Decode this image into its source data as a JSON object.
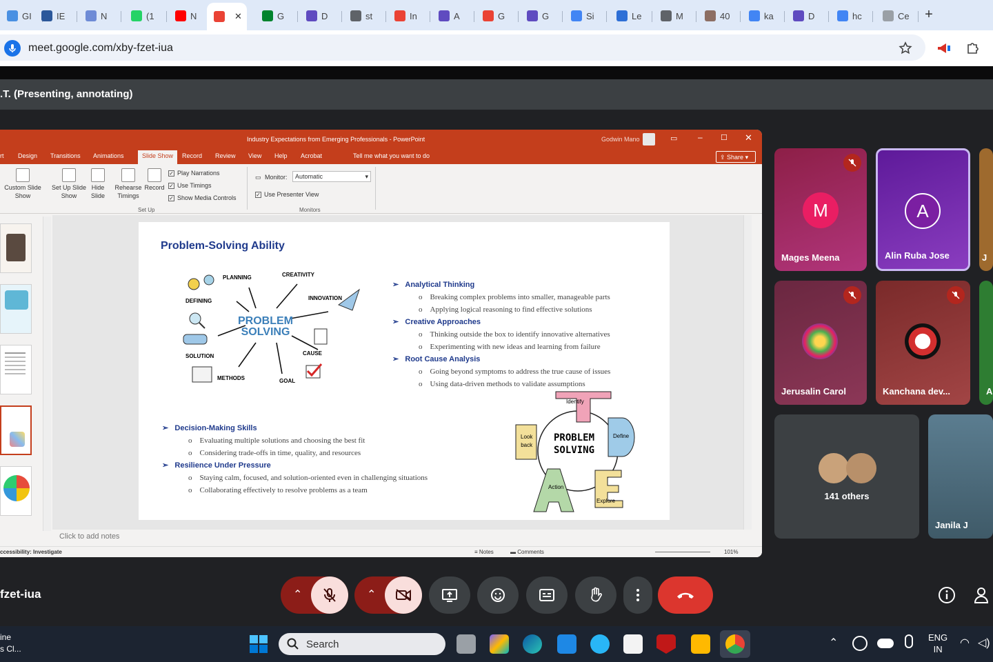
{
  "browser": {
    "tabs": [
      {
        "label": "GI",
        "color": "#4a90e2"
      },
      {
        "label": "IE",
        "color": "#2b579a"
      },
      {
        "label": "N",
        "color": "#6e8bd6"
      },
      {
        "label": "(1",
        "color": "#25d366"
      },
      {
        "label": "N",
        "color": "#ff0000"
      },
      {
        "label": "",
        "color": "#ea4335"
      },
      {
        "label": "G",
        "color": "#00832d"
      },
      {
        "label": "D",
        "color": "#5f4bc0"
      },
      {
        "label": "st",
        "color": "#5f6368"
      },
      {
        "label": "In",
        "color": "#ea4335"
      },
      {
        "label": "A",
        "color": "#5f4bc0"
      },
      {
        "label": "G",
        "color": "#ea4335"
      },
      {
        "label": "G",
        "color": "#5f4bc0"
      },
      {
        "label": "Si",
        "color": "#4285f4"
      },
      {
        "label": "Le",
        "color": "#2e6fd6"
      },
      {
        "label": "M",
        "color": "#5f6368"
      },
      {
        "label": "40",
        "color": "#8d6e63"
      },
      {
        "label": "ka",
        "color": "#4285f4"
      },
      {
        "label": "D",
        "color": "#5f4bc0"
      },
      {
        "label": "hc",
        "color": "#4285f4"
      },
      {
        "label": "Ce",
        "color": "#9aa0a6"
      }
    ],
    "new_tab": "+",
    "url": "meet.google.com/xby-fzet-iua"
  },
  "meet": {
    "presenting_label": ".T. (Presenting, annotating)",
    "meeting_code": "fzet-iua"
  },
  "ppt": {
    "window_title": "Industry Expectations from Emerging Professionals  -  PowerPoint",
    "user_name": "Godwin Mano",
    "tabs": [
      "rt",
      "Design",
      "Transitions",
      "Animations",
      "Slide Show",
      "Record",
      "Review",
      "View",
      "Help",
      "Acrobat",
      "Tell me what you want to do"
    ],
    "share": "Share",
    "ribbon": {
      "custom_slide_show": "Custom Slide Show",
      "set_up_slide_show": "Set Up Slide Show",
      "hide_slide": "Hide Slide",
      "rehearse_timings": "Rehearse Timings",
      "record": "Record",
      "play_narrations": "Play Narrations",
      "use_timings": "Use Timings",
      "show_media_controls": "Show Media Controls",
      "set_up_group": "Set Up",
      "monitor_label": "Monitor:",
      "monitor_value": "Automatic",
      "use_presenter_view": "Use Presenter View",
      "monitors_group": "Monitors"
    },
    "notes_placeholder": "Click to add notes",
    "status": {
      "accessibility": "ccessibility: Investigate",
      "notes": "Notes",
      "comments": "Comments",
      "zoom": "101%"
    }
  },
  "slide": {
    "title": "Problem-Solving Ability",
    "diagram": {
      "center1": "PROBLEM",
      "center2": "SOLVING",
      "labels": [
        "PLANNING",
        "CREATIVITY",
        "INNOVATION",
        "DEFINING",
        "SOLUTION",
        "METHODS",
        "GOAL",
        "CAUSE"
      ]
    },
    "right_bullets": [
      {
        "head": "Analytical Thinking",
        "items": [
          "Breaking complex problems into smaller, manageable parts",
          "Applying logical reasoning to find effective solutions"
        ]
      },
      {
        "head": "Creative Approaches",
        "items": [
          "Thinking outside the box to identify innovative alternatives",
          "Experimenting with new ideas and learning from failure"
        ]
      },
      {
        "head": "Root Cause Analysis",
        "items": [
          "Going beyond symptoms to address the true cause of issues",
          "Using data-driven methods to validate assumptions"
        ]
      }
    ],
    "left_bullets": [
      {
        "head": "Decision-Making Skills",
        "items": [
          "Evaluating multiple solutions and choosing the best fit",
          "Considering trade-offs in time, quality, and resources"
        ]
      },
      {
        "head": "Resilience Under Pressure",
        "items": [
          "Staying calm, focused, and solution-oriented even in challenging situations",
          "Collaborating effectively to resolve problems as a team"
        ]
      }
    ],
    "ideal": {
      "center1": "PROBLEM",
      "center2": "SOLVING",
      "identify": "Identify",
      "define": "Define",
      "explore": "Explore",
      "action": "Action",
      "look1": "Look",
      "look2": "back"
    }
  },
  "participants": [
    {
      "name": "Mages Meena",
      "initial": "M",
      "muted": true
    },
    {
      "name": "Alin Ruba Jose",
      "initial": "A",
      "muted": false
    },
    {
      "name": "Jerusalin Carol",
      "muted": true
    },
    {
      "name": "Kanchana dev...",
      "muted": true
    },
    {
      "name": "141 others"
    },
    {
      "name": "Janila J"
    },
    {
      "name": "J"
    },
    {
      "name": "A"
    }
  ],
  "taskbar": {
    "search": "Search",
    "lang1": "ENG",
    "lang2": "IN",
    "left1": "ine",
    "left2": "s Cl..."
  }
}
